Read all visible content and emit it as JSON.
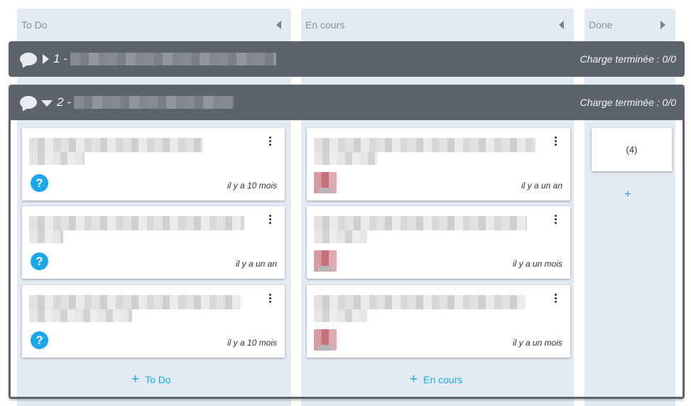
{
  "columns": [
    {
      "title": "To Do"
    },
    {
      "title": "En cours"
    },
    {
      "title": "Done"
    }
  ],
  "swimlanes": [
    {
      "number": "1 -",
      "summary": "Charge terminée : 0/0",
      "expanded": false
    },
    {
      "number": "2 -",
      "summary": "Charge terminée : 0/0",
      "expanded": true
    }
  ],
  "todo_cards": [
    {
      "time": "il y a 10 mois",
      "status_icon": "question-icon"
    },
    {
      "time": "il y a un an",
      "status_icon": "question-icon"
    },
    {
      "time": "il y a 10 mois",
      "status_icon": "question-icon"
    }
  ],
  "encours_cards": [
    {
      "time": "il y a un an",
      "assignee": "avatar"
    },
    {
      "time": "il y a un mois",
      "assignee": "avatar"
    },
    {
      "time": "il y a un mois",
      "assignee": "avatar"
    }
  ],
  "done": {
    "count": "(4)",
    "add_glyph": "+"
  },
  "add_buttons": {
    "todo": "To Do",
    "encours": "En cours",
    "glyph": "+"
  },
  "colors": {
    "accent": "#1aa7ec",
    "lane": "#5d636c",
    "column": "#e4eaf3"
  }
}
